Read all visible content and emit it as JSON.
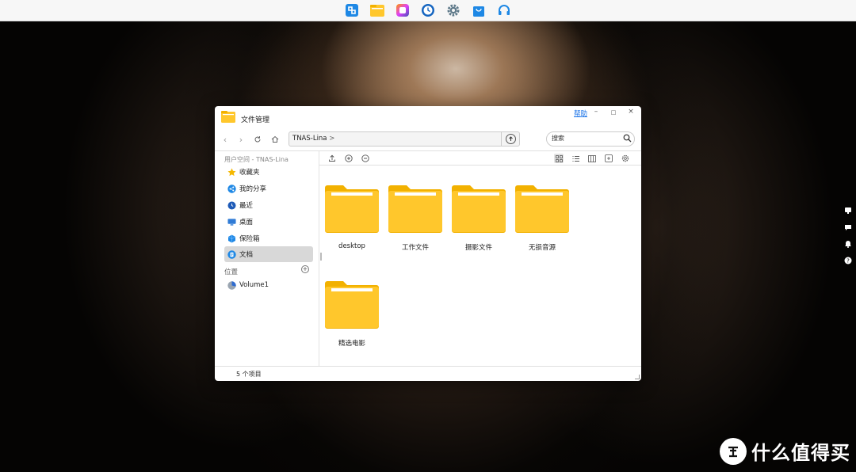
{
  "dock": {
    "items": [
      {
        "name": "control-panel-icon",
        "color": "#1e88e5"
      },
      {
        "name": "file-manager-icon",
        "color": "#ffc72c"
      },
      {
        "name": "photo-app-icon",
        "color": "#e040fb"
      },
      {
        "name": "clock-icon",
        "color": "#1565c0"
      },
      {
        "name": "settings-gear-icon",
        "color": "#607d8b"
      },
      {
        "name": "app-store-bag-icon",
        "color": "#1e88e5"
      },
      {
        "name": "support-headset-icon",
        "color": "#1e88e5"
      }
    ]
  },
  "window": {
    "title": "文件管理",
    "help": "帮助",
    "minimize": "–",
    "maximize": "□",
    "close": "×"
  },
  "toolbar": {
    "path": "TNAS-Lina",
    "path_chevron": ">",
    "search_placeholder": "搜索"
  },
  "sidebar": {
    "user_section": "用户空间 - TNAS-Lina",
    "items": [
      {
        "label": "收藏夹",
        "icon": "star-icon",
        "color": "#f5b800"
      },
      {
        "label": "我的分享",
        "icon": "share-icon",
        "color": "#1e88e5"
      },
      {
        "label": "最近",
        "icon": "recent-icon",
        "color": "#1e5bb8"
      },
      {
        "label": "桌面",
        "icon": "desktop-icon",
        "color": "#2f7bd6"
      },
      {
        "label": "保险箱",
        "icon": "safe-box-icon",
        "color": "#1e88e5"
      },
      {
        "label": "文档",
        "icon": "document-icon",
        "color": "#1e88e5"
      }
    ],
    "active_index": 5,
    "location_section": "位置",
    "location_add": "+",
    "volume": {
      "label": "Volume1",
      "icon": "volume-disk-icon"
    }
  },
  "folders": [
    {
      "name": "desktop"
    },
    {
      "name": "工作文件"
    },
    {
      "name": "摄影文件"
    },
    {
      "name": "无损音源"
    },
    {
      "name": "精选电影"
    }
  ],
  "status": {
    "text": "5 个项目"
  },
  "watermark": {
    "text": "什么值得买",
    "logo": "值"
  },
  "colors": {
    "folder": "#ffc72c",
    "folder_dark": "#f2b100",
    "accent": "#1a73e8"
  }
}
